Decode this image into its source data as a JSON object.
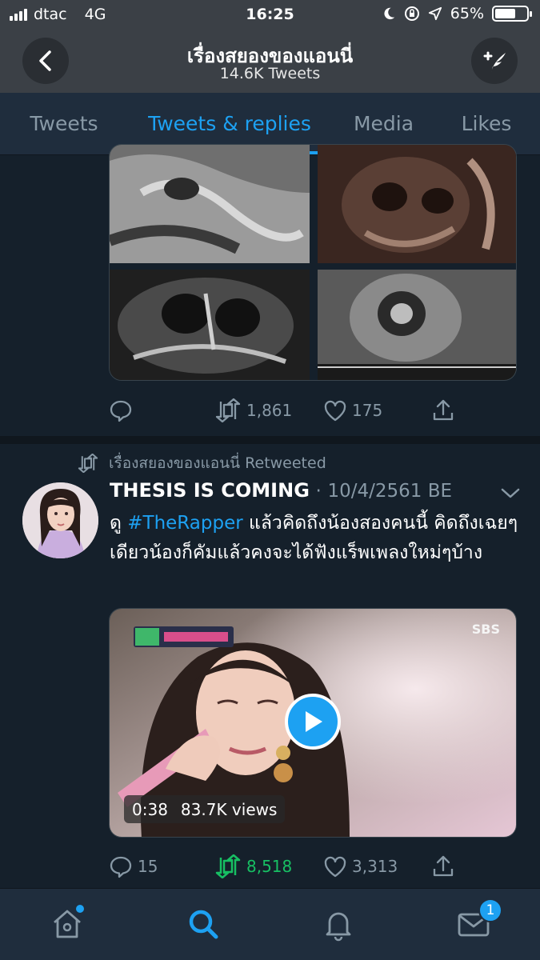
{
  "status_bar": {
    "carrier": "dtac",
    "network": "4G",
    "time": "16:25",
    "battery": "65%",
    "battery_level": 0.65
  },
  "header": {
    "title": "เรื่องสยองของแอนนี่",
    "subtitle": "14.6K Tweets"
  },
  "tabs": [
    {
      "label": "Tweets",
      "active": false
    },
    {
      "label": "Tweets & replies",
      "active": true
    },
    {
      "label": "Media",
      "active": false
    },
    {
      "label": "Likes",
      "active": false
    }
  ],
  "tweet1": {
    "replies": "",
    "retweets": "1,861",
    "likes": "175"
  },
  "tweet2": {
    "retweet_by": "เรื่องสยองของแอนนี่ Retweeted",
    "name": "THESIS IS COMING",
    "separator": "·",
    "date": "10/4/2561 BE",
    "text_before": "ดู ",
    "hashtag": "#TheRapper",
    "text_after": " แล้วคิดถึงน้องสองคนนี้ คิดถึงเฉยๆเดียวน้องก็คัมแล้วคงจะได้ฟังแร็พเพลงใหม่ๆบ้าง",
    "video_duration": "0:38",
    "video_views": "83.7K views",
    "video_watermark": "SBS",
    "replies": "15",
    "retweets": "8,518",
    "likes": "3,313"
  },
  "bottom_nav": {
    "messages_badge": "1"
  },
  "colors": {
    "accent": "#1da1f2",
    "retweet_green": "#17bf63",
    "background": "#15202b"
  }
}
